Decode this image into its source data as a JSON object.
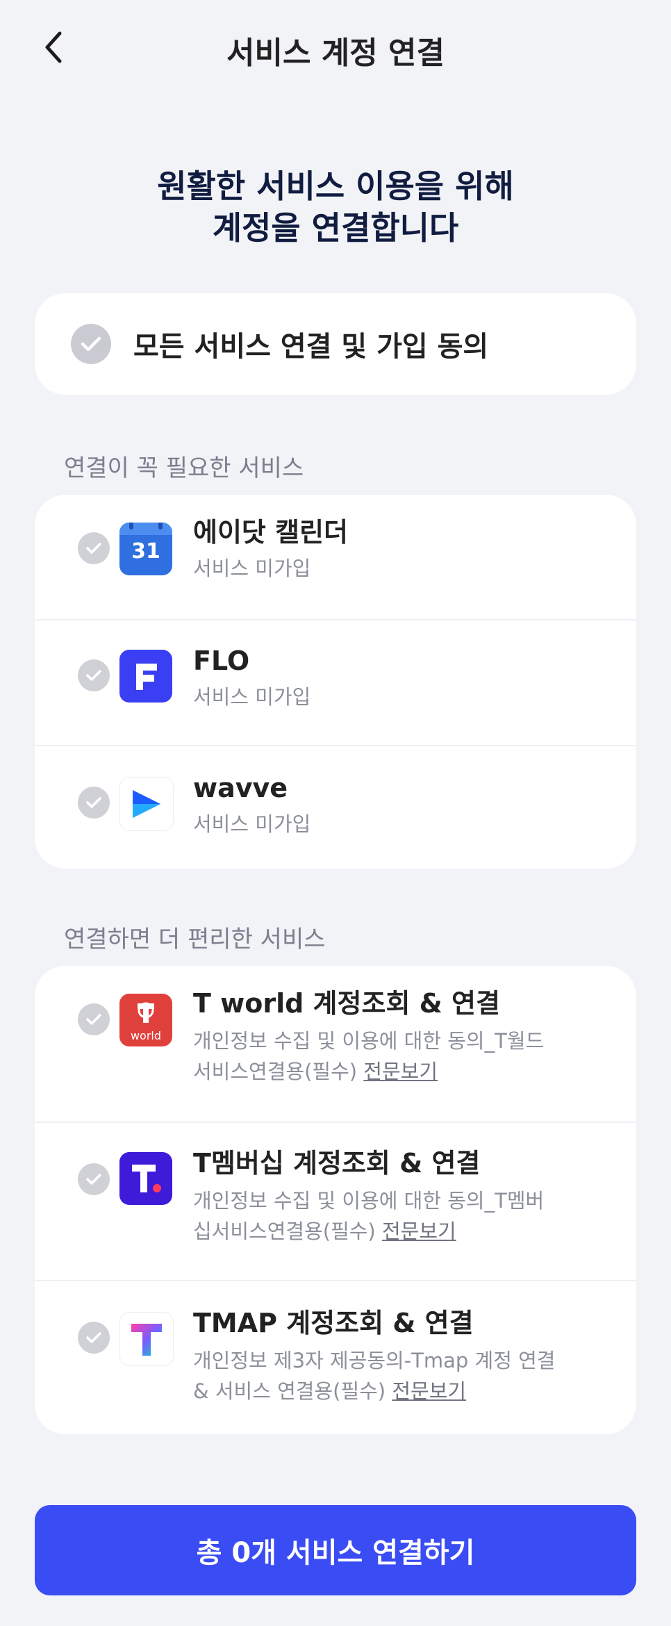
{
  "header": {
    "title": "서비스 계정 연결",
    "back_icon": "chevron-left-icon"
  },
  "intro": {
    "line1": "원활한 서비스 이용을 위해",
    "line2": "계정을 연결합니다"
  },
  "agree_all": {
    "label": "모든 서비스 연결 및 가입 동의"
  },
  "required_section": {
    "label": "연결이 꼭 필요한 서비스",
    "items": [
      {
        "name": "에이닷 캘린더",
        "status": "서비스 미가입",
        "icon": "calendar-icon",
        "icon_text": "31"
      },
      {
        "name": "FLO",
        "status": "서비스 미가입",
        "icon": "flo-icon"
      },
      {
        "name": "wavve",
        "status": "서비스 미가입",
        "icon": "wavve-icon"
      }
    ]
  },
  "optional_section": {
    "label": "연결하면 더 편리한 서비스",
    "items": [
      {
        "name": "T world 계정조회 & 연결",
        "desc_line1": "개인정보 수집 및 이용에 대한 동의_T월드",
        "desc_line2": "서비스연결용(필수)",
        "link": "전문보기",
        "icon": "tworld-icon",
        "icon_text": "world"
      },
      {
        "name": "T멤버십 계정조회 & 연결",
        "desc_line1": "개인정보 수집 및 이용에 대한 동의_T멤버",
        "desc_line2": "십서비스연결용(필수)",
        "link": "전문보기",
        "icon": "tmembership-icon"
      },
      {
        "name": "TMAP 계정조회 & 연결",
        "desc_line1": "개인정보 제3자 제공동의-Tmap 계정 연결",
        "desc_line2": "& 서비스 연결용(필수)",
        "link": "전문보기",
        "icon": "tmap-icon"
      }
    ]
  },
  "cta": {
    "label": "총 0개 서비스 연결하기"
  },
  "colors": {
    "accent": "#3a4cf3",
    "background": "#f2f3f7",
    "check_inactive": "#c9cad2"
  }
}
